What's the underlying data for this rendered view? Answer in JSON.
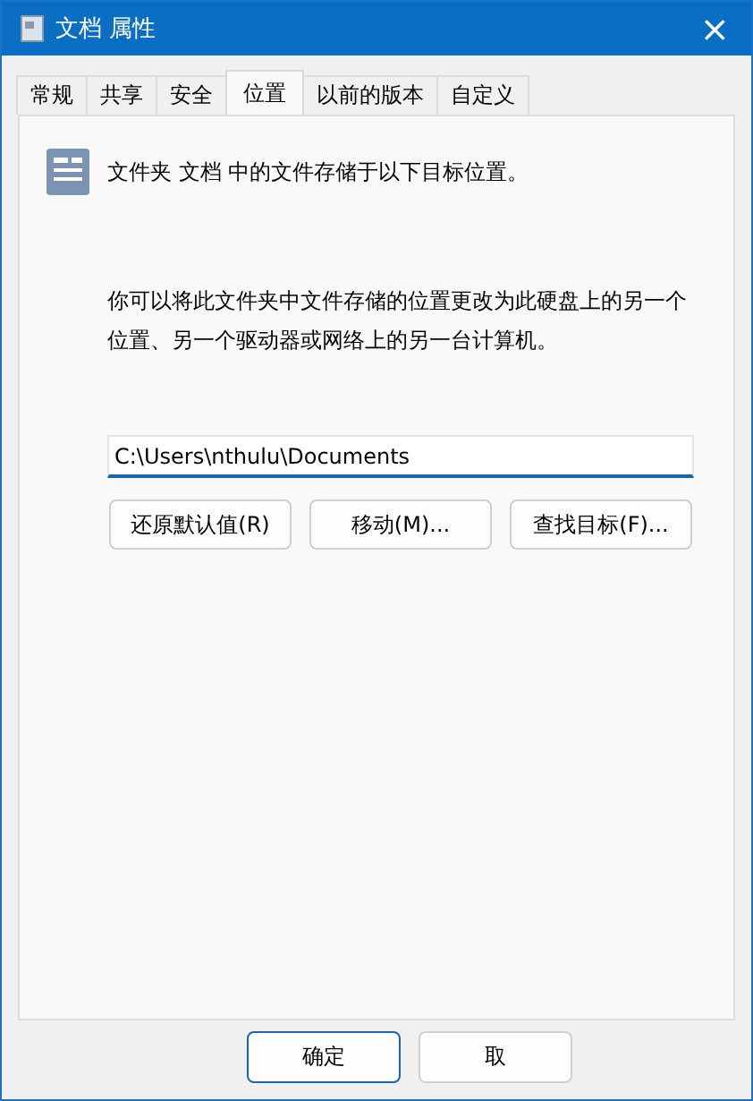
{
  "window": {
    "title": "文档 属性",
    "close": "×"
  },
  "tabs": [
    {
      "label": "常规",
      "selected": false
    },
    {
      "label": "共享",
      "selected": false
    },
    {
      "label": "安全",
      "selected": false
    },
    {
      "label": "位置",
      "selected": true
    },
    {
      "label": "以前的版本",
      "selected": false
    },
    {
      "label": "自定义",
      "selected": false
    }
  ],
  "header": "文件夹 文档 中的文件存储于以下目标位置。",
  "description": "你可以将此文件夹中文件存储的位置更改为此硬盘上的另一个位置、另一个驱动器或网络上的另一台计算机。",
  "path_field": {
    "value": "C:\\Users\\nthulu\\Documents"
  },
  "buttons": [
    "还原默认值(R)",
    "移动(M)...",
    "查找目标(F)..."
  ],
  "footer_buttons": [
    {
      "label": "确定",
      "default": true
    },
    {
      "label": "取",
      "default": false
    }
  ]
}
